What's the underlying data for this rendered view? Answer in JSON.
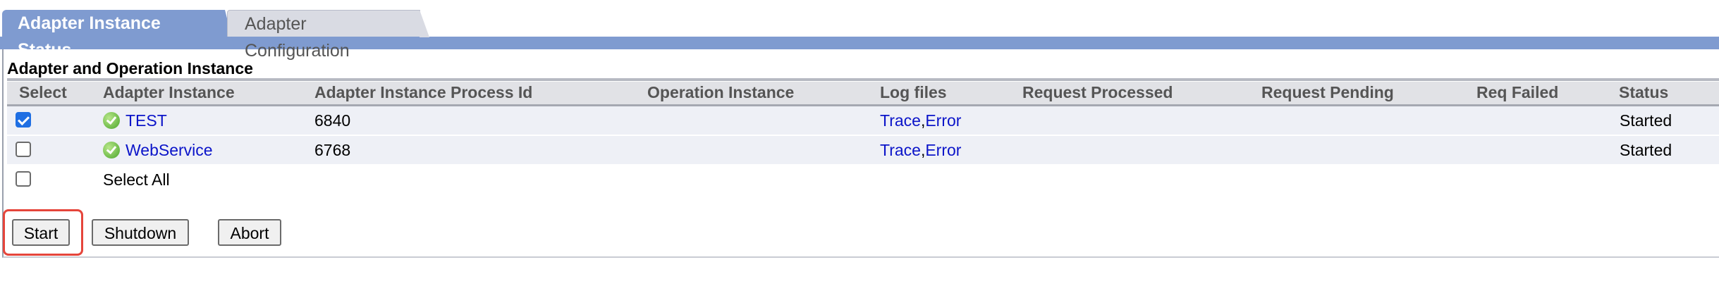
{
  "tabs": [
    {
      "label": "Adapter Instance Status"
    },
    {
      "label": "Adapter Configuration"
    }
  ],
  "section": {
    "title": "Adapter and Operation Instance"
  },
  "table": {
    "headers": {
      "select": "Select",
      "adapter_instance": "Adapter Instance",
      "process_id": "Adapter Instance Process Id",
      "operation_instance": "Operation Instance",
      "log_files": "Log files",
      "request_processed": "Request Processed",
      "request_pending": "Request Pending",
      "req_failed": "Req Failed",
      "status": "Status"
    },
    "rows": [
      {
        "checked": true,
        "name": "TEST",
        "process_id": "6840",
        "operation_instance": "",
        "log_trace": "Trace",
        "log_sep": ",",
        "log_error": "Error",
        "request_processed": "",
        "request_pending": "",
        "req_failed": "",
        "status": "Started"
      },
      {
        "checked": false,
        "name": "WebService",
        "process_id": "6768",
        "operation_instance": "",
        "log_trace": "Trace",
        "log_sep": ",",
        "log_error": "Error",
        "request_processed": "",
        "request_pending": "",
        "req_failed": "",
        "status": "Started"
      }
    ],
    "select_all_label": "Select All"
  },
  "buttons": {
    "start": "Start",
    "shutdown": "Shutdown",
    "abort": "Abort"
  },
  "colors": {
    "tab_active": "#7f9bd0",
    "link": "#0b14c9",
    "highlight": "#e5453b",
    "status_ok": "#4aa52a"
  },
  "icons": {
    "status": "check-circle-icon"
  }
}
